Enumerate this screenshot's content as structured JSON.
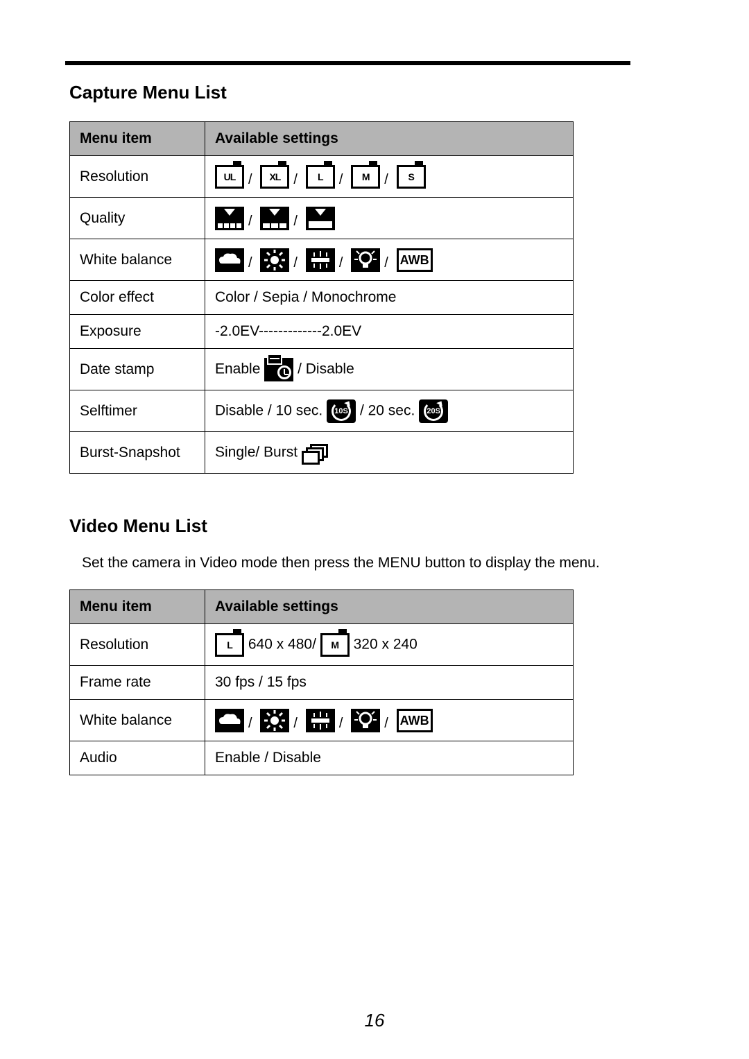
{
  "page_number": "16",
  "capture": {
    "title": "Capture Menu List",
    "headers": {
      "menu_item": "Menu item",
      "settings": "Available settings"
    },
    "rows": {
      "resolution": {
        "label": "Resolution",
        "icons": [
          "UL",
          "XL",
          "L",
          "M",
          "S"
        ]
      },
      "quality": {
        "label": "Quality",
        "levels": [
          4,
          3,
          2
        ]
      },
      "white_balance": {
        "label": "White balance",
        "modes": [
          "cloudy",
          "sunny",
          "fluorescent",
          "tungsten",
          "awb"
        ],
        "awb_label": "AWB"
      },
      "color_effect": {
        "label": "Color effect",
        "value": "Color / Sepia / Monochrome"
      },
      "exposure": {
        "label": "Exposure",
        "value": "-2.0EV-------------2.0EV"
      },
      "date_stamp": {
        "label": "Date stamp",
        "prefix": "Enable",
        "suffix": " / Disable"
      },
      "selftimer": {
        "label": "Selftimer",
        "prefix": "Disable / 10 sec. ",
        "mid": " / 20 sec. ",
        "icon1": "10S",
        "icon2": "20S"
      },
      "burst": {
        "label": "Burst-Snapshot",
        "prefix": "Single/ Burst "
      }
    }
  },
  "video": {
    "title": "Video Menu List",
    "intro": "Set the camera in Video mode then press the MENU button to display the menu.",
    "headers": {
      "menu_item": "Menu item",
      "settings": "Available settings"
    },
    "rows": {
      "resolution": {
        "label": "Resolution",
        "r1_text": " 640 x 480/ ",
        "r2_text": " 320 x 240",
        "icon1": "L",
        "icon2": "M"
      },
      "frame_rate": {
        "label": "Frame rate",
        "value": "30 fps / 15 fps"
      },
      "white_balance": {
        "label": "White balance",
        "awb_label": "AWB"
      },
      "audio": {
        "label": "Audio",
        "value": "Enable / Disable"
      }
    }
  }
}
